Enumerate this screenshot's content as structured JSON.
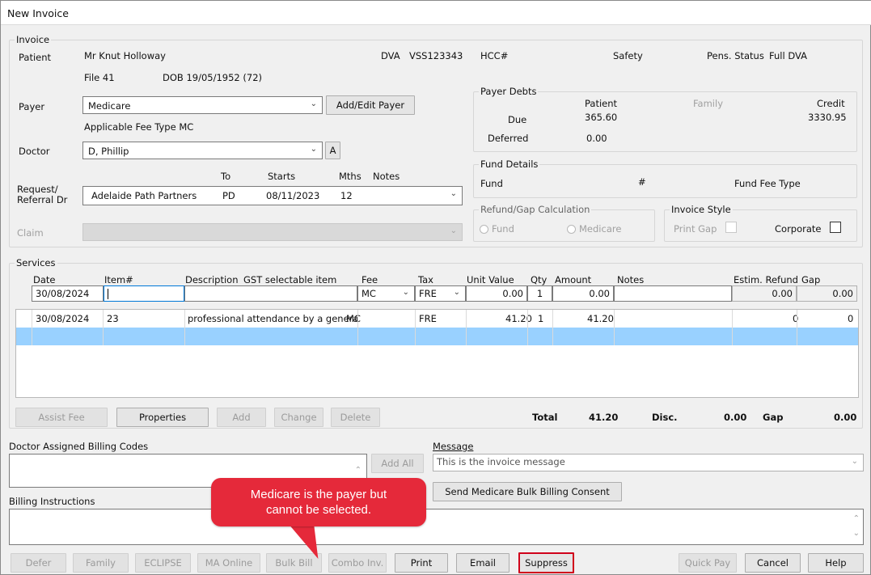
{
  "window": {
    "title": "New Invoice"
  },
  "invoice": {
    "group_label": "Invoice",
    "patient_label": "Patient",
    "patient_name": "Mr Knut Holloway",
    "dva_label": "DVA",
    "dva_value": "VSS123343",
    "hcc_label": "HCC#",
    "safety_label": "Safety",
    "pens_status_label": "Pens. Status",
    "pens_status_value": "Full DVA",
    "file_label": "File 41",
    "dob_label": "DOB 19/05/1952 (72)",
    "payer_label": "Payer",
    "payer_value": "Medicare",
    "add_edit_payer": "Add/Edit Payer",
    "fee_type": "Applicable Fee Type MC",
    "doctor_label": "Doctor",
    "doctor_value": "D, Phillip",
    "doctor_a_button": "A",
    "ref_header_to": "To",
    "ref_header_starts": "Starts",
    "ref_header_mths": "Mths",
    "ref_header_notes": "Notes",
    "request_label_1": "Request/",
    "request_label_2": "Referral Dr",
    "ref_name": "Adelaide Path Partners",
    "ref_to": "PD",
    "ref_starts": "08/11/2023",
    "ref_mths": "12",
    "claim_label": "Claim"
  },
  "payer_debts": {
    "label": "Payer Debts",
    "patient_col": "Patient",
    "family_col": "Family",
    "credit_col": "Credit",
    "due_label": "Due",
    "due_patient": "365.60",
    "credit_value": "3330.95",
    "deferred_label": "Deferred",
    "deferred_patient": "0.00"
  },
  "fund_details": {
    "label": "Fund Details",
    "fund_col": "Fund",
    "hash_col": "#",
    "fee_type_col": "Fund Fee Type"
  },
  "refund_gap": {
    "label": "Refund/Gap Calculation",
    "fund_option": "Fund",
    "medicare_option": "Medicare"
  },
  "invoice_style": {
    "label": "Invoice Style",
    "print_gap": "Print Gap",
    "corporate": "Corporate"
  },
  "services": {
    "label": "Services",
    "headers": {
      "date": "Date",
      "item": "Item#",
      "description": "Description",
      "gst": "GST selectable item",
      "fee": "Fee",
      "tax": "Tax",
      "unit_value": "Unit Value",
      "qty": "Qty",
      "amount": "Amount",
      "notes": "Notes",
      "estim_refund": "Estim. Refund",
      "gap": "Gap"
    },
    "entry": {
      "date": "30/08/2024",
      "item": "",
      "fee": "MC",
      "tax": "FRE",
      "unit_value": "0.00",
      "qty": "1",
      "amount": "0.00",
      "refund": "0.00",
      "gap": "0.00"
    },
    "rows": [
      {
        "date": "30/08/2024",
        "item": "23",
        "description": "professional attendance by a genera",
        "fee": "MC",
        "tax": "FRE",
        "unit_value": "41.20",
        "qty": "1",
        "amount": "41.20",
        "refund": "0",
        "gap": "0"
      }
    ],
    "buttons": {
      "assist_fee": "Assist Fee",
      "properties": "Properties",
      "add": "Add",
      "change": "Change",
      "delete": "Delete"
    },
    "totals": {
      "total_label": "Total",
      "total_value": "41.20",
      "disc_label": "Disc.",
      "disc_value": "0.00",
      "gap_label": "Gap",
      "gap_value": "0.00"
    }
  },
  "billing": {
    "doctor_codes_label": "Doctor Assigned Billing Codes",
    "add_all": "Add All",
    "message_label": "Message",
    "message_value": "This is the invoice message",
    "bulk_consent": "Send Medicare Bulk Billing Consent",
    "instructions_label": "Billing Instructions"
  },
  "callout": {
    "line1": "Medicare is the payer but",
    "line2": "cannot be selected."
  },
  "footer": {
    "defer": "Defer",
    "family": "Family",
    "eclipse": "ECLIPSE",
    "ma_online": "MA Online",
    "bulk_bill": "Bulk Bill",
    "combo_inv": "Combo Inv.",
    "print": "Print",
    "email": "Email",
    "suppress": "Suppress",
    "quick_pay": "Quick Pay",
    "cancel": "Cancel",
    "help": "Help"
  },
  "colors": {
    "callout": "#e5293a",
    "selection": "#99d1ff",
    "suppress_highlight": "#d0021b"
  }
}
